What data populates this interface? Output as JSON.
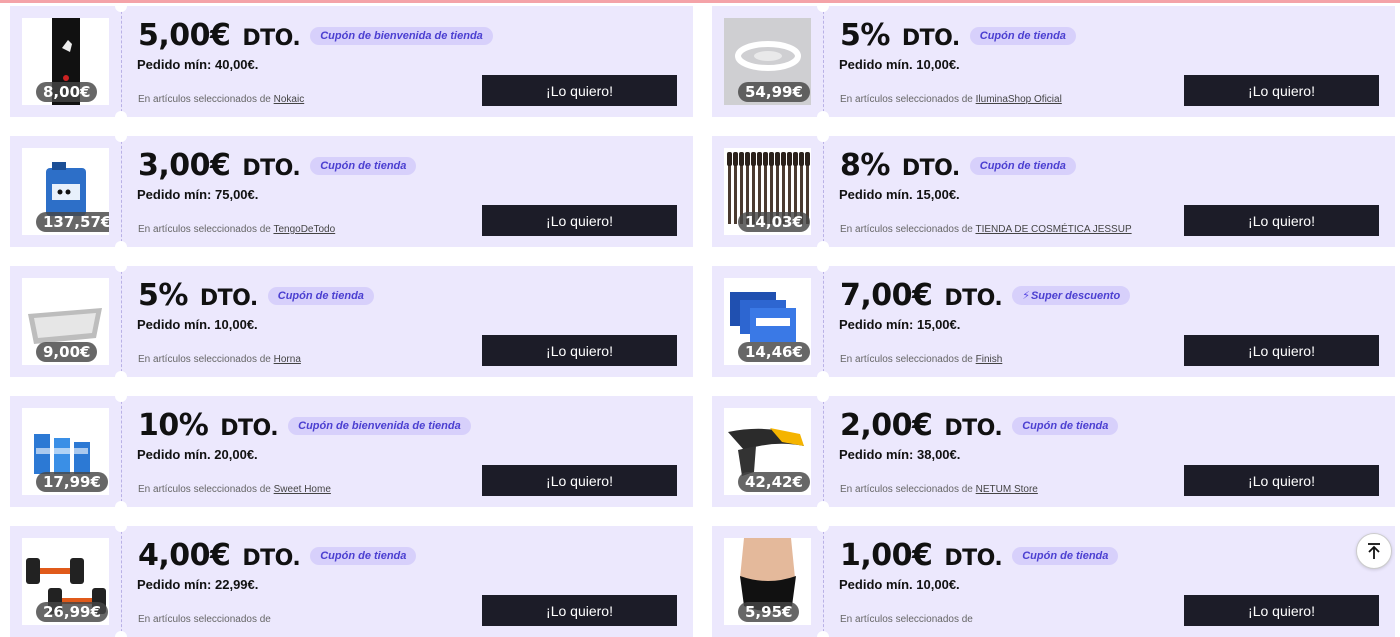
{
  "coupons": [
    {
      "thumb_icon": "phone-case-icon",
      "price": "8,00€",
      "amount": "5,00€",
      "dto": "DTO.",
      "tag": "Cupón de bienvenida de tienda",
      "min": "Pedido mín: 40,00€.",
      "fine_prefix": "En artículos seleccionados de",
      "store": "Nokaic",
      "cta": "¡Lo quiero!"
    },
    {
      "thumb_icon": "ceiling-fan-lamp-icon",
      "price": "54,99€",
      "amount": "5%",
      "dto": "DTO.",
      "tag": "Cupón de tienda",
      "min": "Pedido mín. 10,00€.",
      "fine_prefix": "En artículos seleccionados de",
      "store": "IluminaShop Oficial",
      "cta": "¡Lo quiero!"
    },
    {
      "thumb_icon": "canister-icon",
      "price": "137,57€",
      "amount": "3,00€",
      "dto": "DTO.",
      "tag": "Cupón de tienda",
      "min": "Pedido mín: 75,00€.",
      "fine_prefix": "En artículos seleccionados de",
      "store": "TengoDeTodo",
      "cta": "¡Lo quiero!"
    },
    {
      "thumb_icon": "makeup-brushes-icon",
      "price": "14,03€",
      "amount": "8%",
      "dto": "DTO.",
      "tag": "Cupón de tienda",
      "min": "Pedido mín. 15,00€.",
      "fine_prefix": "En artículos seleccionados de",
      "store": "TIENDA DE COSMÉTICA JESSUP",
      "cta": "¡Lo quiero!"
    },
    {
      "thumb_icon": "litter-box-icon",
      "price": "9,00€",
      "amount": "5%",
      "dto": "DTO.",
      "tag": "Cupón de tienda",
      "min": "Pedido mín. 10,00€.",
      "fine_prefix": "En artículos seleccionados de",
      "store": "Horna",
      "cta": "¡Lo quiero!"
    },
    {
      "thumb_icon": "detergent-boxes-icon",
      "price": "14,46€",
      "amount": "7,00€",
      "dto": "DTO.",
      "tag": "Super descuento",
      "tag_bolt": true,
      "min": "Pedido mín: 15,00€.",
      "fine_prefix": "En artículos seleccionados de",
      "store": "Finish",
      "cta": "¡Lo quiero!"
    },
    {
      "thumb_icon": "cleaning-bottles-icon",
      "price": "17,99€",
      "amount": "10%",
      "dto": "DTO.",
      "tag": "Cupón de bienvenida de tienda",
      "min": "Pedido mín. 20,00€.",
      "fine_prefix": "En artículos seleccionados de",
      "store": "Sweet Home",
      "cta": "¡Lo quiero!"
    },
    {
      "thumb_icon": "barcode-scanner-icon",
      "price": "42,42€",
      "amount": "2,00€",
      "dto": "DTO.",
      "tag": "Cupón de tienda",
      "min": "Pedido mín: 38,00€.",
      "fine_prefix": "En artículos seleccionados de",
      "store": "NETUM Store",
      "cta": "¡Lo quiero!"
    },
    {
      "thumb_icon": "dumbbells-icon",
      "price": "26,99€",
      "amount": "4,00€",
      "dto": "DTO.",
      "tag": "Cupón de tienda",
      "min": "Pedido mín: 22,99€.",
      "fine_prefix": "En artículos seleccionados de",
      "store": "",
      "cta": "¡Lo quiero!"
    },
    {
      "thumb_icon": "shapewear-icon",
      "price": "5,95€",
      "amount": "1,00€",
      "dto": "DTO.",
      "tag": "Cupón de tienda",
      "min": "Pedido mín. 10,00€.",
      "fine_prefix": "En artículos seleccionados de",
      "store": "",
      "cta": "¡Lo quiero!"
    }
  ],
  "scroll_top_icon": "arrow-up-to-top-icon",
  "colors": {
    "card_bg": "#ece8fd",
    "tag_bg": "#d7d0fb",
    "tag_text": "#4b3fd1",
    "cta_bg": "#1c1c28",
    "top_line": "#f4a3a8"
  }
}
